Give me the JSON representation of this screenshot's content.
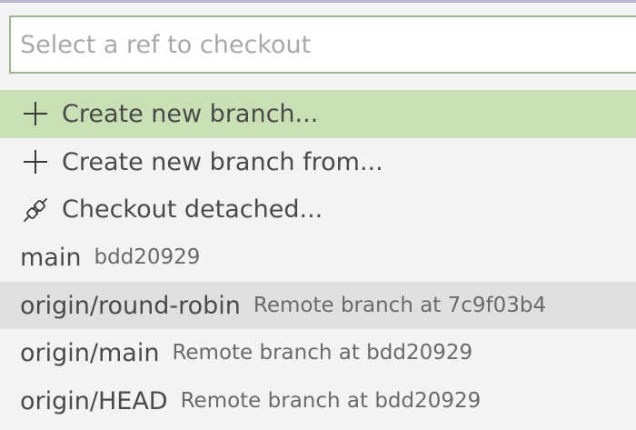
{
  "search": {
    "placeholder": "Select a ref to checkout",
    "value": ""
  },
  "items": [
    {
      "icon": "plus-icon",
      "label": "Create new branch...",
      "description": ""
    },
    {
      "icon": "plus-icon",
      "label": "Create new branch from...",
      "description": ""
    },
    {
      "icon": "plug-disconnect-icon",
      "label": "Checkout detached...",
      "description": ""
    },
    {
      "icon": "",
      "label": "main",
      "description": "bdd20929"
    },
    {
      "icon": "",
      "label": "origin/round-robin",
      "description": "Remote branch at 7c9f03b4"
    },
    {
      "icon": "",
      "label": "origin/main",
      "description": "Remote branch at bdd20929"
    },
    {
      "icon": "",
      "label": "origin/HEAD",
      "description": "Remote branch at bdd20929"
    }
  ],
  "colors": {
    "active_row": "#c9dfb4",
    "hover_row": "#e0e0e0",
    "input_border": "#9db591",
    "background": "#f3f3f3"
  }
}
